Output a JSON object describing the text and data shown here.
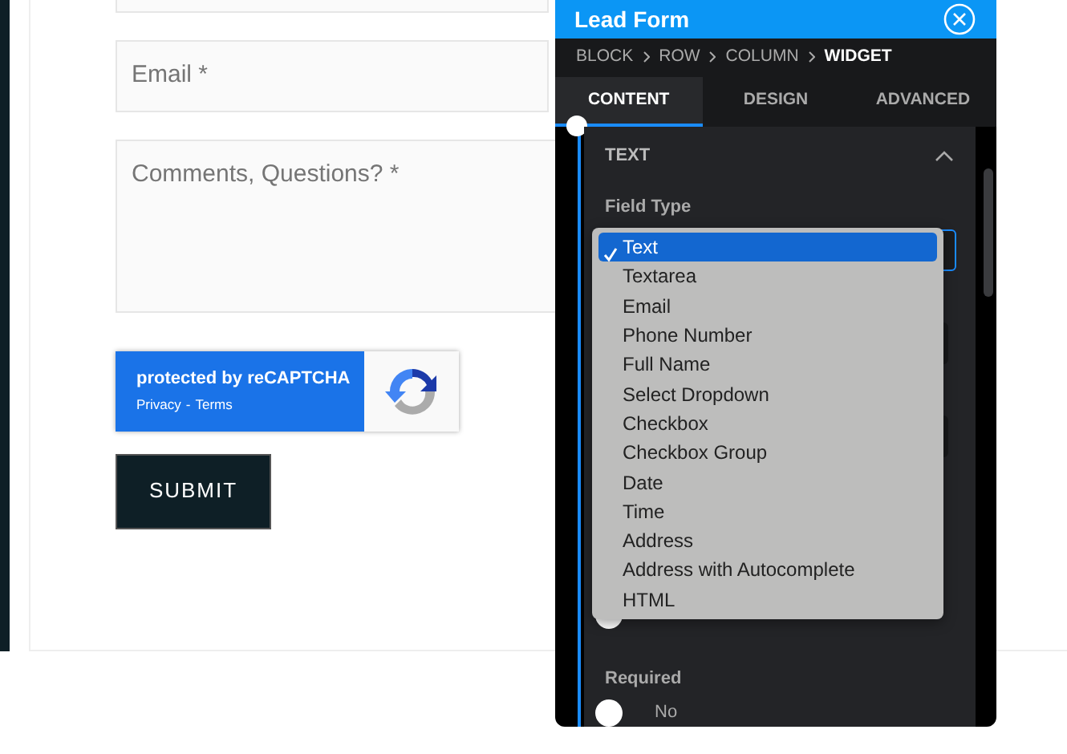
{
  "form": {
    "fields": [
      {
        "kind": "input"
      },
      {
        "kind": "input",
        "placeholder": "Email *"
      },
      {
        "kind": "textarea",
        "placeholder": "Comments, Questions? *"
      }
    ],
    "recaptcha": {
      "title": "protected by reCAPTCHA",
      "privacy": "Privacy",
      "separator": "-",
      "terms": "Terms"
    },
    "submit": "SUBMIT"
  },
  "panel": {
    "title": "Lead Form",
    "breadcrumb": [
      {
        "label": "BLOCK",
        "current": false
      },
      {
        "label": "ROW",
        "current": false
      },
      {
        "label": "COLUMN",
        "current": false
      },
      {
        "label": "WIDGET",
        "current": true
      }
    ],
    "tabs": [
      {
        "label": "CONTENT",
        "selected": true
      },
      {
        "label": "DESIGN",
        "selected": false
      },
      {
        "label": "ADVANCED",
        "selected": false
      }
    ],
    "section": {
      "title": "TEXT",
      "expanded": true,
      "field_label": "Field Type",
      "options": [
        {
          "label": "Text",
          "selected": true
        },
        {
          "label": "Textarea",
          "selected": false
        },
        {
          "label": "Email",
          "selected": false
        },
        {
          "label": "Phone Number",
          "selected": false
        },
        {
          "label": "Full Name",
          "selected": false
        },
        {
          "label": "Select Dropdown",
          "selected": false
        },
        {
          "label": "Checkbox",
          "selected": false
        },
        {
          "label": "Checkbox Group",
          "selected": false
        },
        {
          "label": "Date",
          "selected": false
        },
        {
          "label": "Time",
          "selected": false
        },
        {
          "label": "Address",
          "selected": false
        },
        {
          "label": "Address with Autocomplete",
          "selected": false
        },
        {
          "label": "HTML",
          "selected": false
        }
      ],
      "required_label": "Required",
      "required": {
        "on": false,
        "label": "No"
      }
    }
  }
}
